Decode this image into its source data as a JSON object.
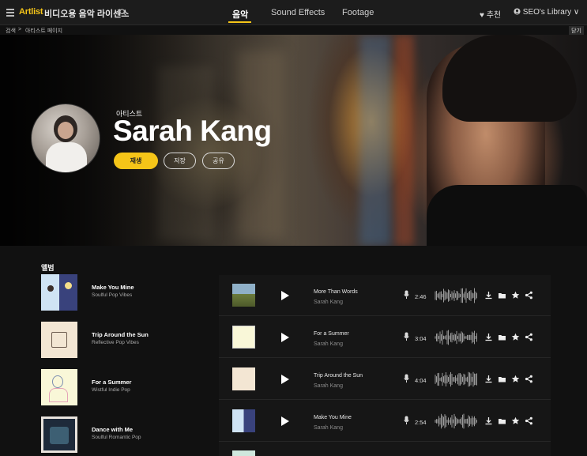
{
  "nav": {
    "logo": "Artlist",
    "site_title": "비디오용 음악 라이센스",
    "tabs": [
      "음악",
      "Sound Effects",
      "Footage"
    ],
    "active_tab": "음악",
    "recommend": "♥ 추천",
    "library": "SEO's Library ∨"
  },
  "breadcrumb": {
    "home": "검색",
    "sep": ">",
    "current": "아티스트 페이지",
    "close": "닫기"
  },
  "hero": {
    "label": "아티스트",
    "name": "Sarah Kang",
    "play": "재생",
    "save": "저장",
    "share": "공유"
  },
  "albums": {
    "title": "앨범",
    "items": [
      {
        "title": "Make You Mine",
        "subtitle": "Soulful Pop Vibes"
      },
      {
        "title": "Trip Around the Sun",
        "subtitle": "Reflective Pop Vibes"
      },
      {
        "title": "For a Summer",
        "subtitle": "Wistful Indie Pop"
      },
      {
        "title": "Dance with Me",
        "subtitle": "Soulful Romantic Pop"
      }
    ]
  },
  "tracks": [
    {
      "title": "More Than Words",
      "artist": "Sarah Kang",
      "duration": "2:46"
    },
    {
      "title": "For a Summer",
      "artist": "Sarah Kang",
      "duration": "3:04"
    },
    {
      "title": "Trip Around the Sun",
      "artist": "Sarah Kang",
      "duration": "4:04"
    },
    {
      "title": "Make You Mine",
      "artist": "Sarah Kang",
      "duration": "2:54"
    }
  ],
  "colors": {
    "accent": "#f5c518",
    "background": "#111111",
    "row_bg": "#161616"
  }
}
